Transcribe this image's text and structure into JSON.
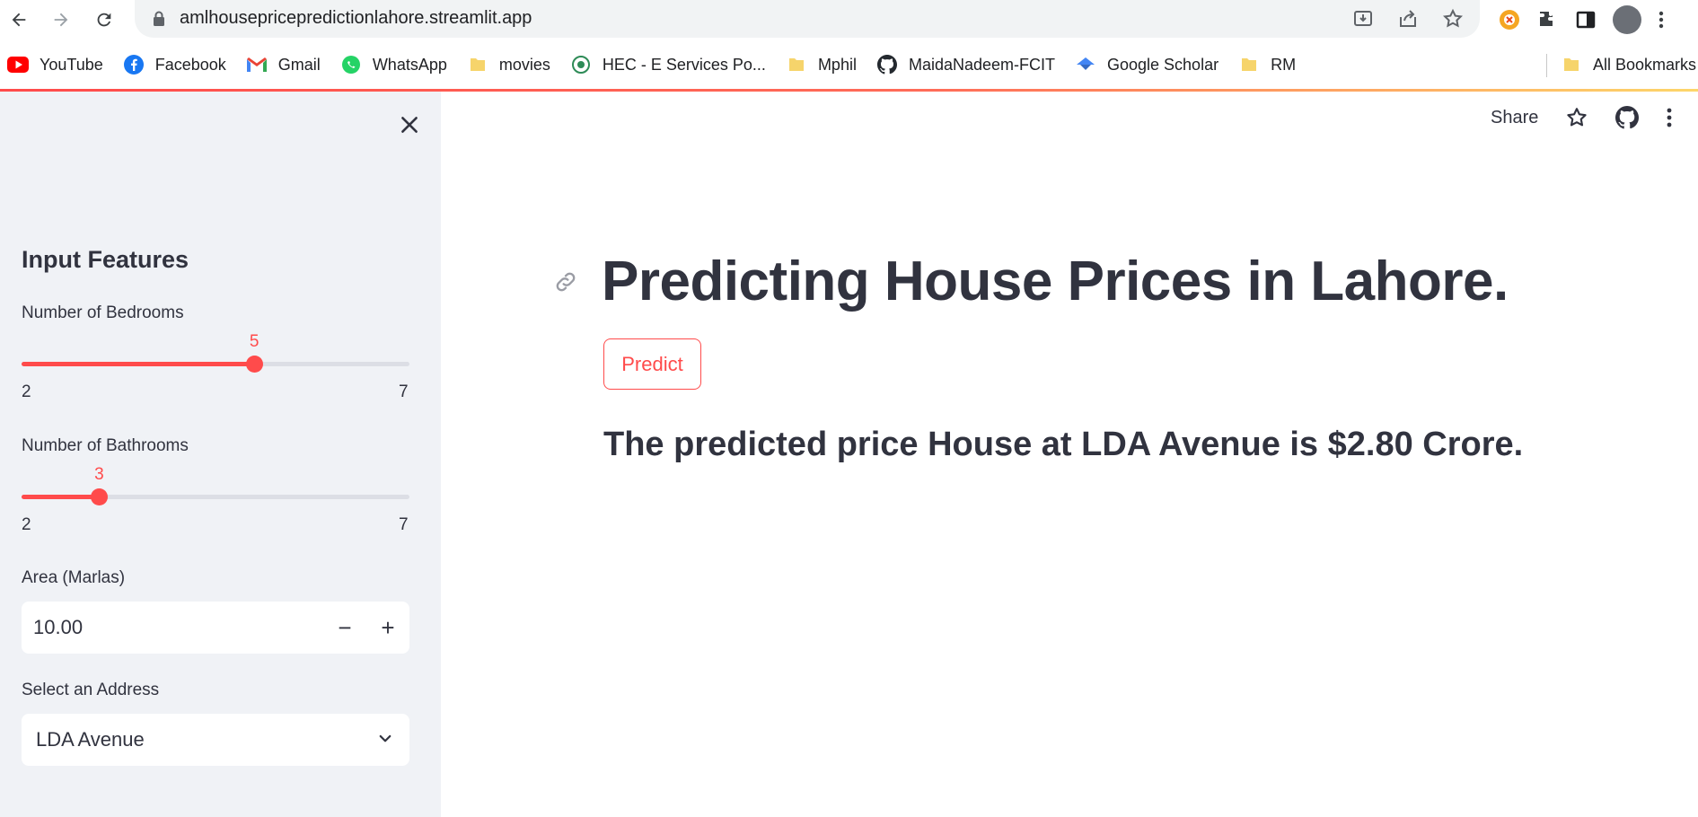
{
  "browser": {
    "url": "amlhousepricepredictionlahore.streamlit.app",
    "bookmarks": [
      {
        "label": "YouTube",
        "icon": "youtube-icon"
      },
      {
        "label": "Facebook",
        "icon": "facebook-icon"
      },
      {
        "label": "Gmail",
        "icon": "gmail-icon"
      },
      {
        "label": "WhatsApp",
        "icon": "whatsapp-icon"
      },
      {
        "label": "movies",
        "icon": "folder-icon"
      },
      {
        "label": "HEC - E Services Po...",
        "icon": "hec-icon"
      },
      {
        "label": "Mphil",
        "icon": "folder-icon"
      },
      {
        "label": "MaidaNadeem-FCIT",
        "icon": "github-icon"
      },
      {
        "label": "Google Scholar",
        "icon": "scholar-icon"
      },
      {
        "label": "RM",
        "icon": "folder-icon"
      }
    ],
    "all_bookmarks": "All Bookmarks"
  },
  "sidebar": {
    "heading": "Input Features",
    "bedrooms": {
      "label": "Number of Bedrooms",
      "value": 5,
      "min": 2,
      "max": 7
    },
    "bathrooms": {
      "label": "Number of Bathrooms",
      "value": 3,
      "min": 2,
      "max": 7
    },
    "area": {
      "label": "Area (Marlas)",
      "value": "10.00",
      "minus": "−",
      "plus": "+"
    },
    "address": {
      "label": "Select an Address",
      "value": "LDA Avenue"
    }
  },
  "header": {
    "share": "Share"
  },
  "main": {
    "title": "Predicting House Prices in Lahore.",
    "predict_button": "Predict",
    "result": "The predicted price House at LDA Avenue is $2.80 Crore."
  },
  "colors": {
    "accent": "#ff4b4b",
    "sidebar_bg": "#f0f2f6",
    "text": "#31333f"
  }
}
